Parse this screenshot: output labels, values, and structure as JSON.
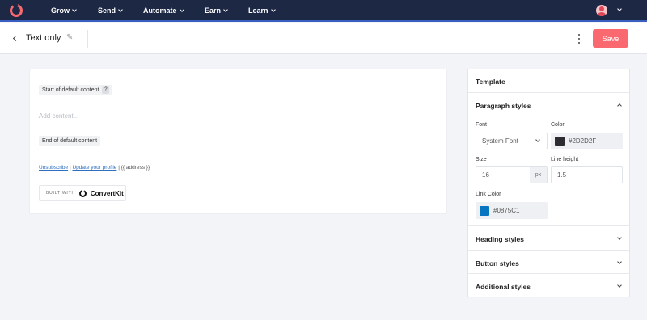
{
  "nav": {
    "items": [
      {
        "label": "Grow"
      },
      {
        "label": "Send"
      },
      {
        "label": "Automate"
      },
      {
        "label": "Earn"
      },
      {
        "label": "Learn"
      }
    ]
  },
  "header": {
    "title": "Text only",
    "save_label": "Save"
  },
  "email": {
    "start_tag": "Start of default content",
    "help_badge": "?",
    "add_content_placeholder": "Add content...",
    "end_tag": "End of default content",
    "unsubscribe_link": "Unsubscribe",
    "separator": "|",
    "update_profile_link": "Update your profile",
    "address_text": "| {{ address }}",
    "built_with_label": "BUILT WITH",
    "brand_name": "ConvertKit"
  },
  "panel": {
    "template_label": "Template",
    "paragraph_styles_label": "Paragraph styles",
    "font_label": "Font",
    "font_value": "System Font",
    "color_label": "Color",
    "color_value": "#2D2D2F",
    "size_label": "Size",
    "size_value": "16",
    "size_unit": "px",
    "line_height_label": "Line height",
    "line_height_value": "1.5",
    "link_color_label": "Link Color",
    "link_color_value": "#0875C1",
    "heading_styles_label": "Heading styles",
    "button_styles_label": "Button styles",
    "additional_styles_label": "Additional styles"
  },
  "colors": {
    "nav_bg": "#1d2845",
    "brand_accent": "#fb6970",
    "text_color_swatch": "#2D2D2F",
    "link_color_swatch": "#0875C1"
  }
}
